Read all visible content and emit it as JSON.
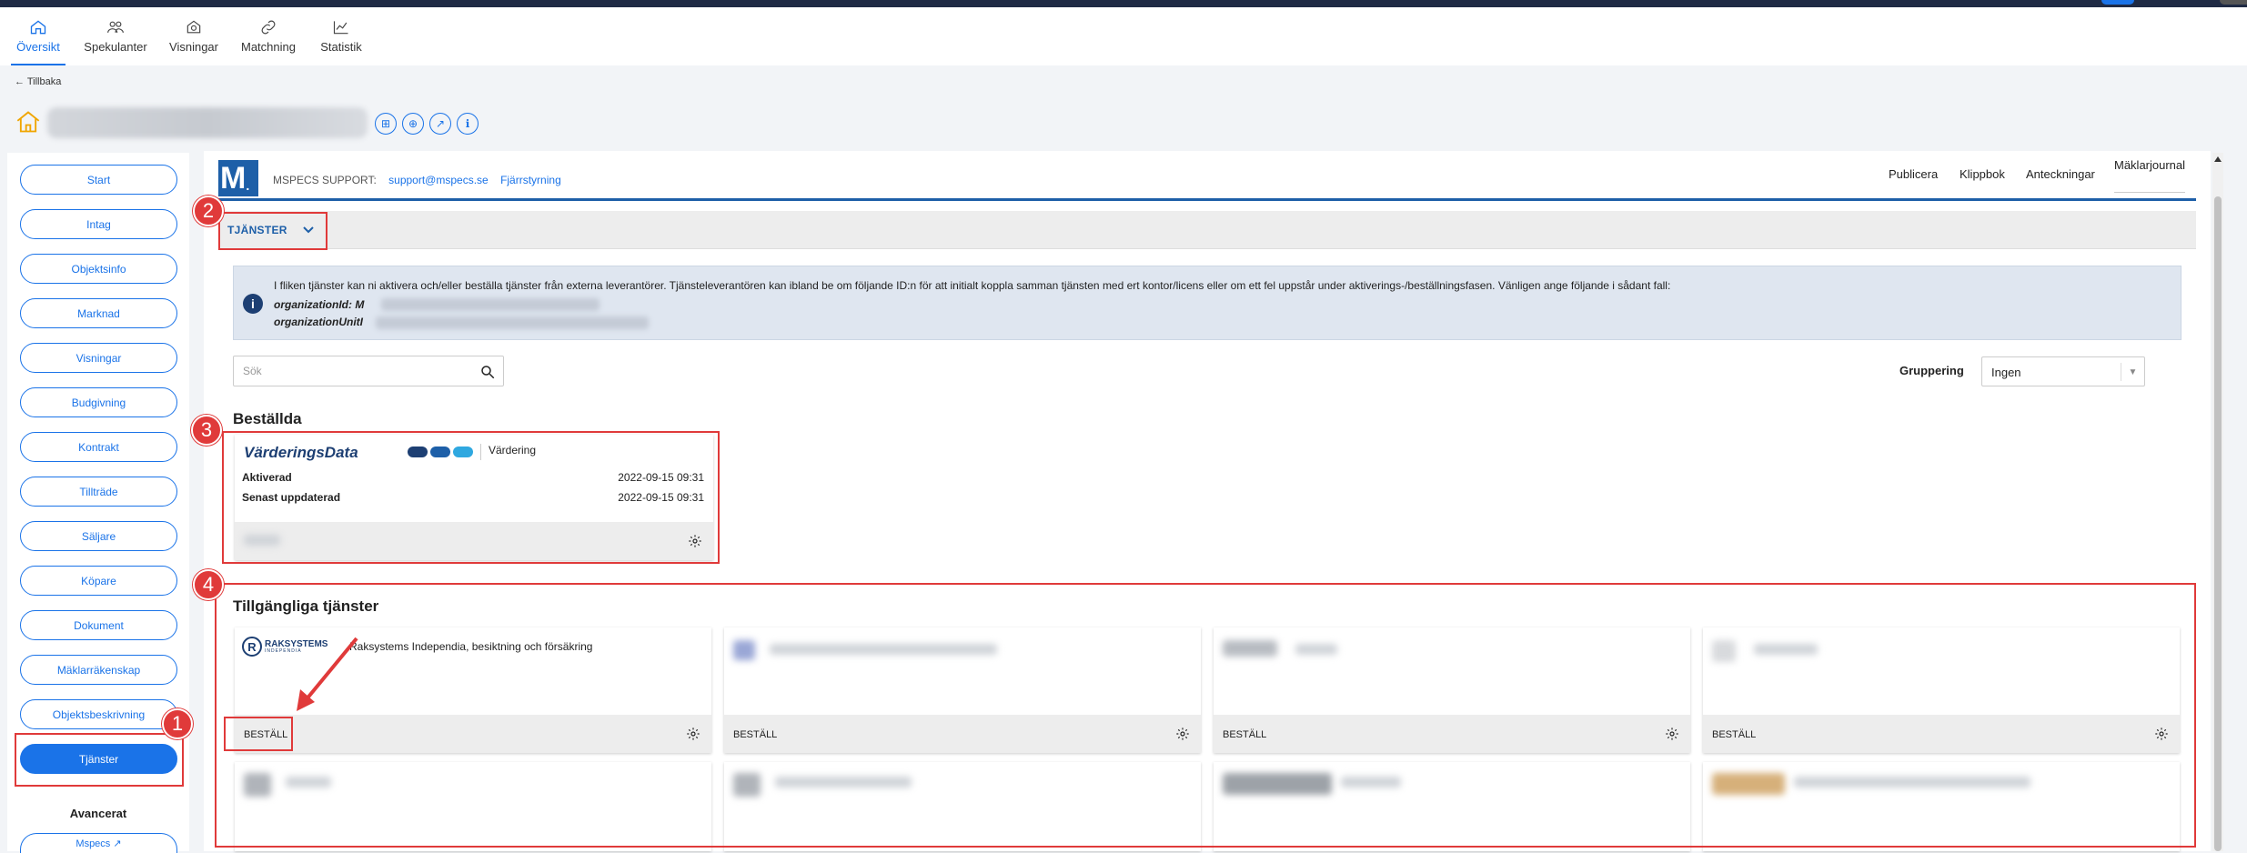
{
  "nav": {
    "items": [
      {
        "label": "Översikt",
        "icon": "home-icon",
        "active": true
      },
      {
        "label": "Spekulanter",
        "icon": "people-icon"
      },
      {
        "label": "Visningar",
        "icon": "showing-icon"
      },
      {
        "label": "Matchning",
        "icon": "link-icon"
      },
      {
        "label": "Statistik",
        "icon": "chart-icon"
      }
    ]
  },
  "back_label": "← Tillbaka",
  "sidebar": {
    "items": [
      "Start",
      "Intag",
      "Objektsinfo",
      "Marknad",
      "Visningar",
      "Budgivning",
      "Kontrakt",
      "Tillträde",
      "Säljare",
      "Köpare",
      "Dokument",
      "Mäklarräkenskap",
      "Objektsbeskrivning",
      "Tjänster"
    ],
    "active": "Tjänster",
    "advanced_heading": "Avancerat",
    "mspecs_link": "Mspecs ↗"
  },
  "header": {
    "logo_text": "M",
    "support_label": "MSPECS SUPPORT:",
    "support_email": "support@mspecs.se",
    "remote_link": "Fjärrstyrning",
    "links": [
      "Publicera",
      "Klippbok",
      "Anteckningar",
      "Mäklarjournal"
    ]
  },
  "services": {
    "tab_label": "TJÄNSTER",
    "info_text": "I fliken tjänster kan ni aktivera och/eller beställa tjänster från externa leverantörer. Tjänsteleverantören kan ibland be om följande ID:n för att initialt koppla samman tjänsten med ert kontor/licens eller om ett fel uppstår under aktiverings-/beställningsfasen. Vänligen ange följande i sådant fall:",
    "org_id_label": "organizationId: M",
    "org_unit_label": "organizationUnitI",
    "search_placeholder": "Sök",
    "grouping_label": "Gruppering",
    "grouping_value": "Ingen"
  },
  "ordered": {
    "heading": "Beställda",
    "card": {
      "logo": "VärderingsData",
      "category": "Värdering",
      "rows": [
        {
          "label": "Aktiverad",
          "value": "2022-09-15 09:31"
        },
        {
          "label": "Senast uppdaterad",
          "value": "2022-09-15 09:31"
        }
      ]
    }
  },
  "available": {
    "heading": "Tillgängliga tjänster",
    "first_card_logo": "RAKSYSTEMS",
    "first_card_logo_sub": "INDEPENDIA",
    "first_card_title": "Raksystems Independia, besiktning och försäkring",
    "order_label": "BESTÄLL"
  },
  "annotations": [
    "1",
    "2",
    "3",
    "4"
  ],
  "colors": {
    "accent": "#1a73e8",
    "brand": "#1d5fa8",
    "annotation": "#e03a3a"
  }
}
